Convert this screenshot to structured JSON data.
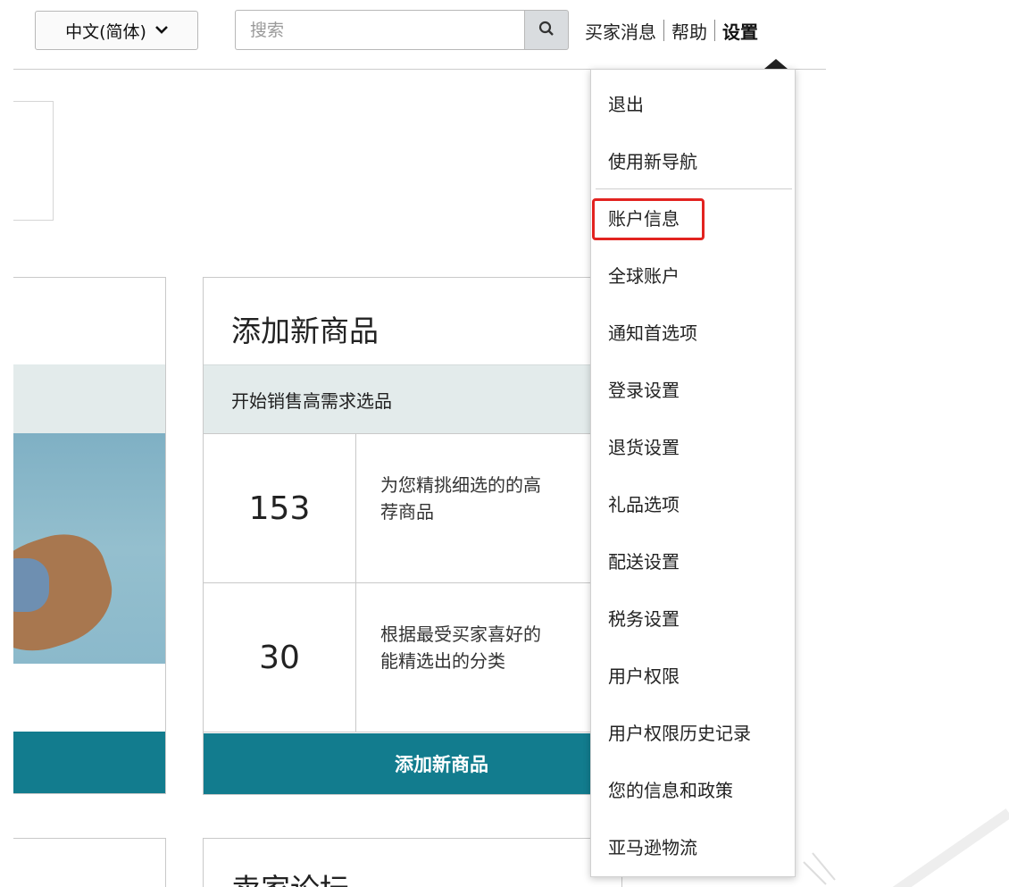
{
  "topbar": {
    "language": "中文(简体)",
    "search_placeholder": "搜索",
    "links": [
      "买家消息",
      "帮助",
      "设置"
    ]
  },
  "add_product_card": {
    "title": "添加新商品",
    "subtitle": "开始销售高需求选品",
    "rows": [
      {
        "count": "153",
        "desc": "为您精挑细选的的高\n荐商品"
      },
      {
        "count": "30",
        "desc": "根据最受买家喜好的\n能精选出的分类"
      }
    ],
    "button": "添加新商品"
  },
  "second_card": {
    "title": "卖家论坛"
  },
  "settings_menu": {
    "items": [
      "退出",
      "使用新导航",
      "账户信息",
      "全球账户",
      "通知首选项",
      "登录设置",
      "退货设置",
      "礼品选项",
      "配送设置",
      "税务设置",
      "用户权限",
      "用户权限历史记录",
      "您的信息和政策",
      "亚马逊物流"
    ],
    "highlighted_item": "账户信息"
  },
  "colors": {
    "accent_teal": "#127c8e",
    "band_gray": "#e3ebeb",
    "highlight_red": "#e22320"
  }
}
